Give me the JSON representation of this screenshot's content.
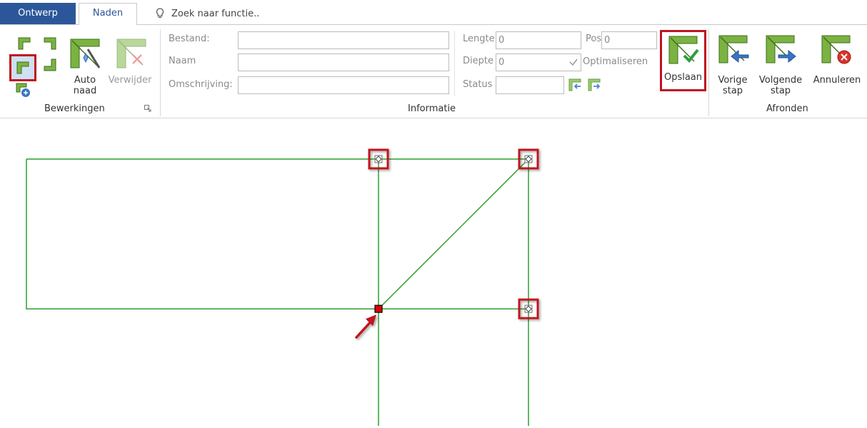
{
  "tabs": {
    "ontwerp": "Ontwerp",
    "naden": "Naden"
  },
  "search": {
    "placeholder": "Zoek naar functie.."
  },
  "groups": {
    "bewerkingen": "Bewerkingen",
    "informatie": "Informatie",
    "afronden": "Afronden"
  },
  "bewerkingen": {
    "auto_naad_line1": "Auto",
    "auto_naad_line2": "naad",
    "verwijder": "Verwijder"
  },
  "fields": {
    "bestand": "Bestand:",
    "naam": "Naam",
    "omschrijving": "Omschrijving:",
    "lengte": "Lengte",
    "lengte_value": "0",
    "diepte": "Diepte",
    "diepte_value": "0",
    "status": "Status",
    "positie": "Positie",
    "positie_value": "0",
    "optimaliseren": "Optimaliseren"
  },
  "buttons": {
    "opslaan": "Opslaan",
    "vorige_line1": "Vorige",
    "vorige_line2": "stap",
    "volgende_line1": "Volgende",
    "volgende_line2": "stap",
    "annuleren": "Annuleren"
  },
  "colors": {
    "accent": "#2b579a",
    "highlight": "#c1121f",
    "seam": "#2ca02c",
    "icon_green": "#6ea93a"
  }
}
